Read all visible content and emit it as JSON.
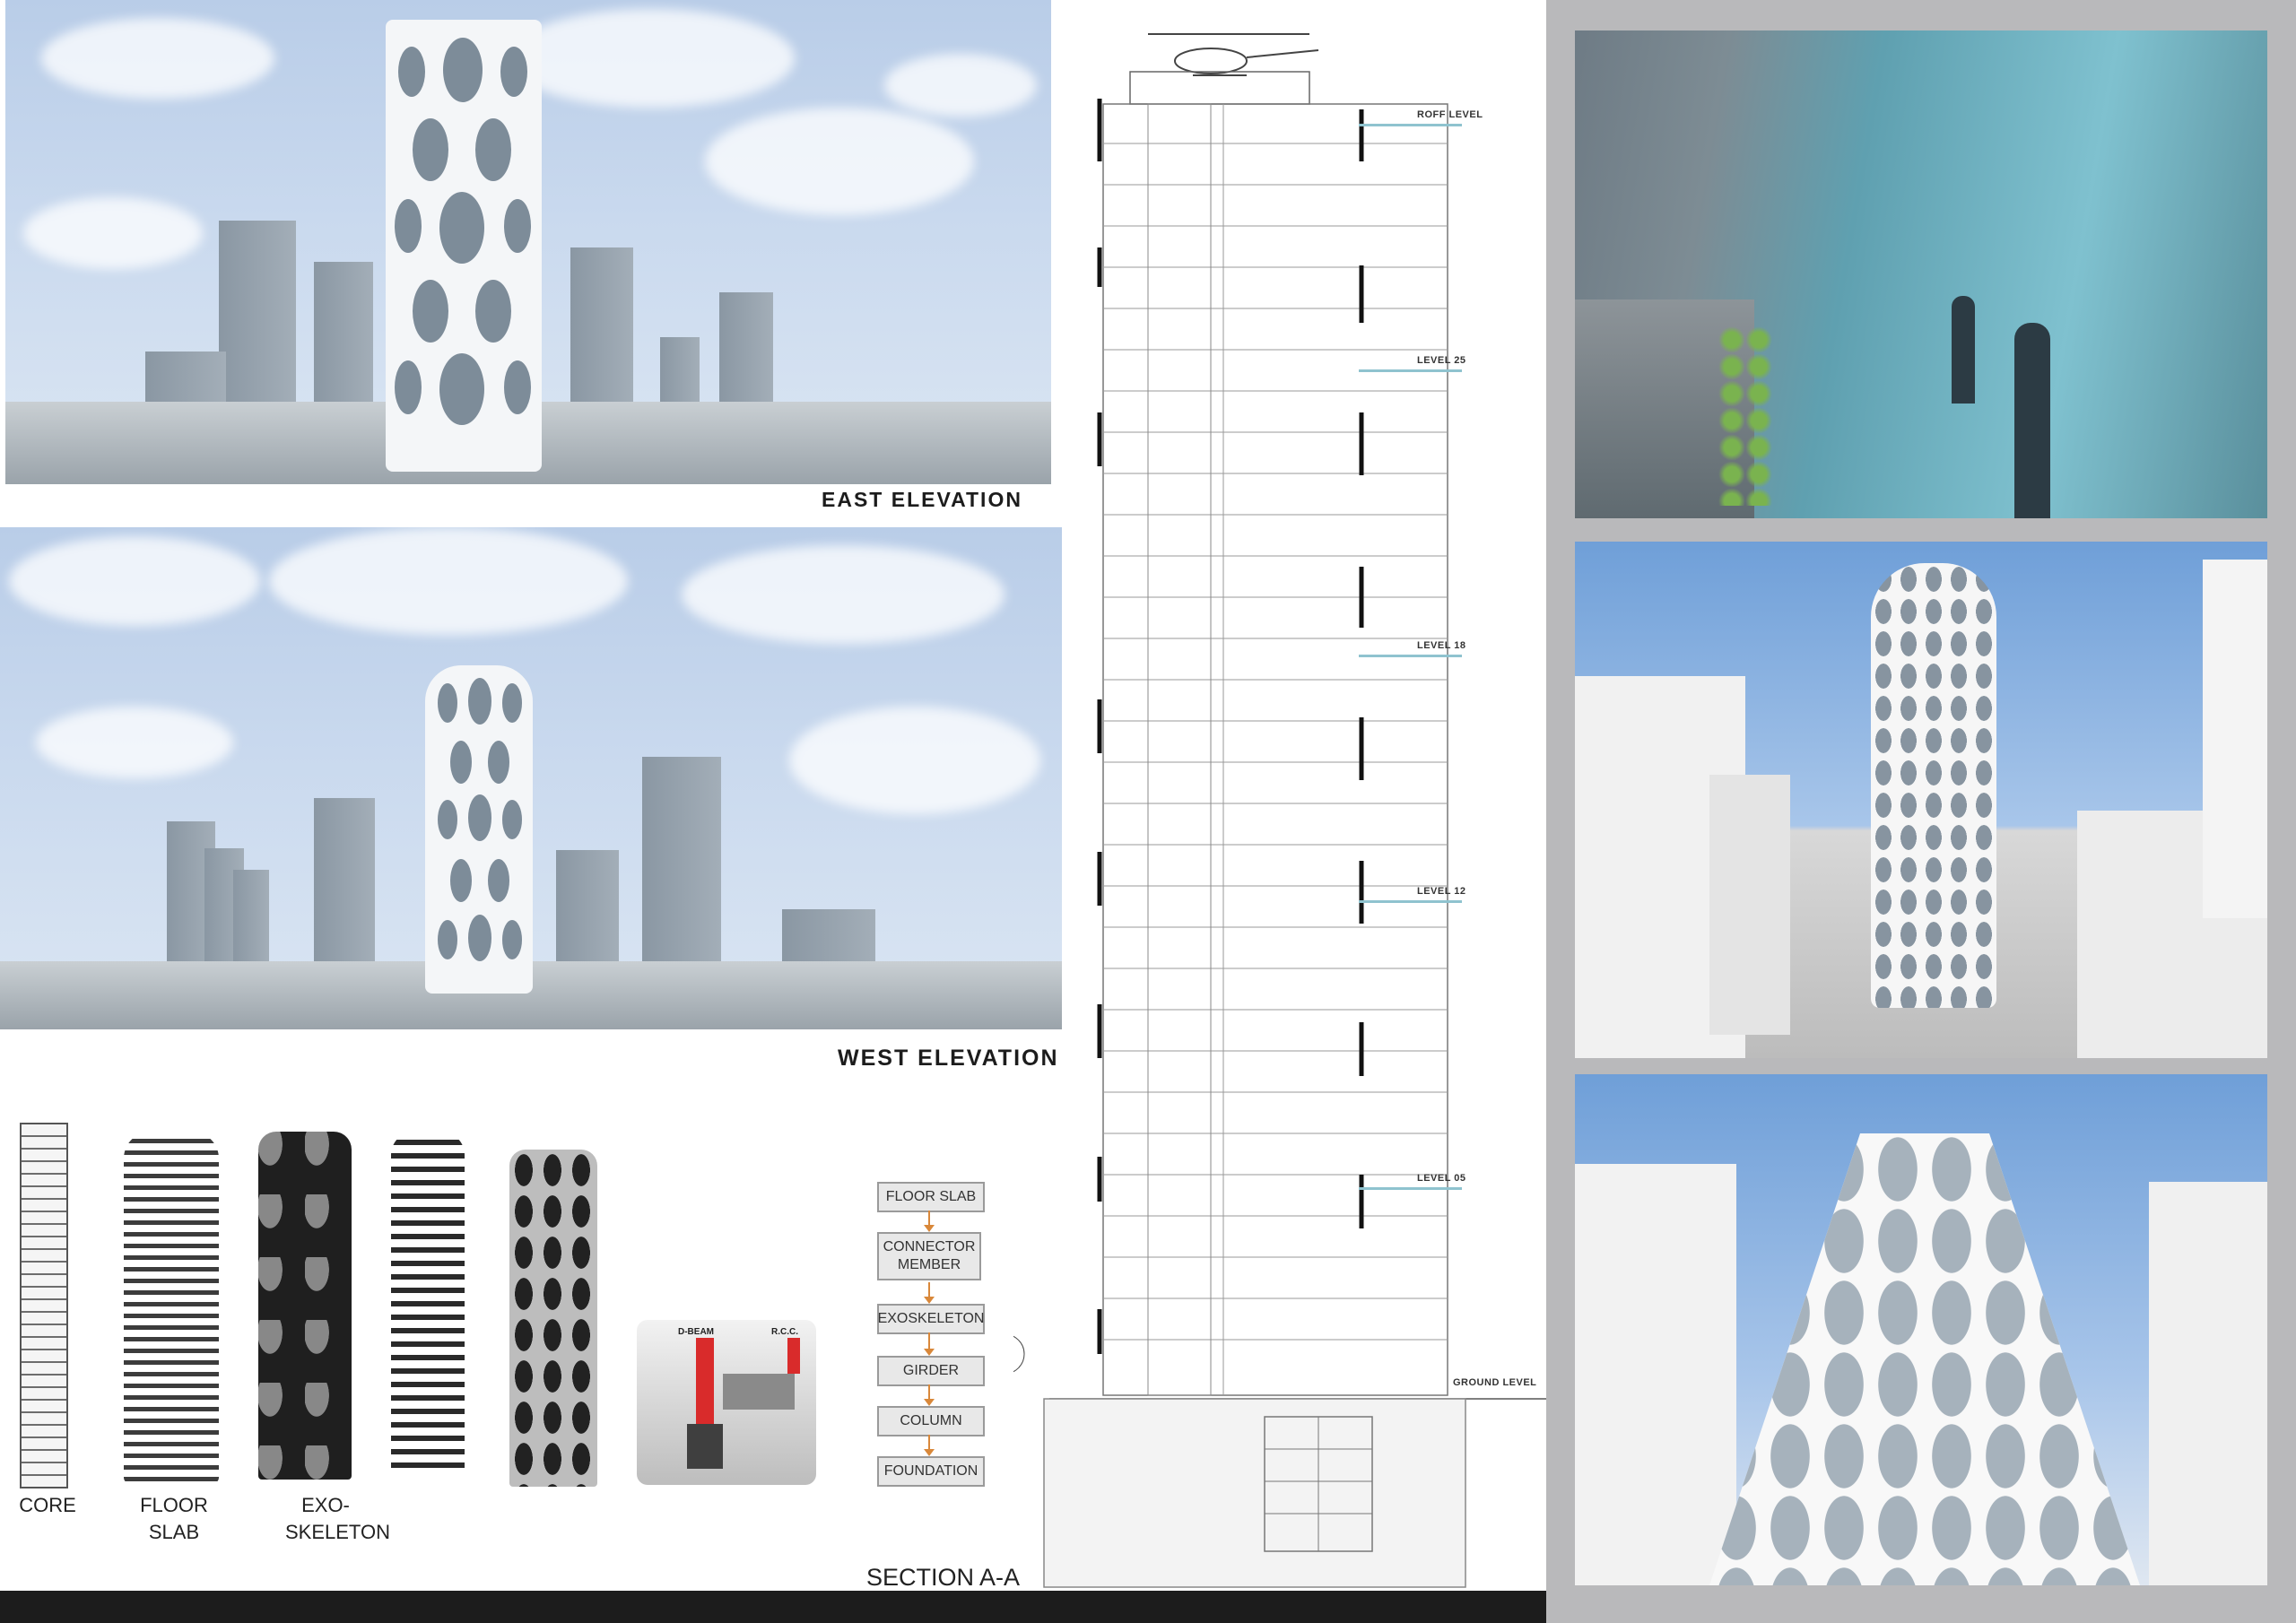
{
  "elevations": {
    "east_label": "EAST ELEVATION",
    "west_label": "WEST ELEVATION"
  },
  "section": {
    "title": "SECTION A-A",
    "levels": [
      "ROFF LEVEL",
      "LEVEL 25",
      "LEVEL 18",
      "LEVEL 12",
      "LEVEL 05"
    ],
    "ground_label": "GROUND LEVEL"
  },
  "flowchart": {
    "steps": [
      "FLOOR SLAB",
      "CONNECTOR MEMBER",
      "EXOSKELETON",
      "GIRDER",
      "COLUMN",
      "FOUNDATION"
    ]
  },
  "components": {
    "labels": [
      "CORE",
      "FLOOR SLAB",
      "EXO-SKELETON"
    ]
  },
  "detail": {
    "beam_label": "D-BEAM",
    "rcc_label": "R.C.C."
  },
  "colors": {
    "sky": "#c6d7ec",
    "building_grey": "#93a0ab",
    "level_line": "#8fc3cf",
    "flow_arrow": "#d9883a",
    "detail_red": "#d92b2b",
    "panel_grey": "#b9b9bb",
    "bottom_bar": "#1c1c1c"
  }
}
